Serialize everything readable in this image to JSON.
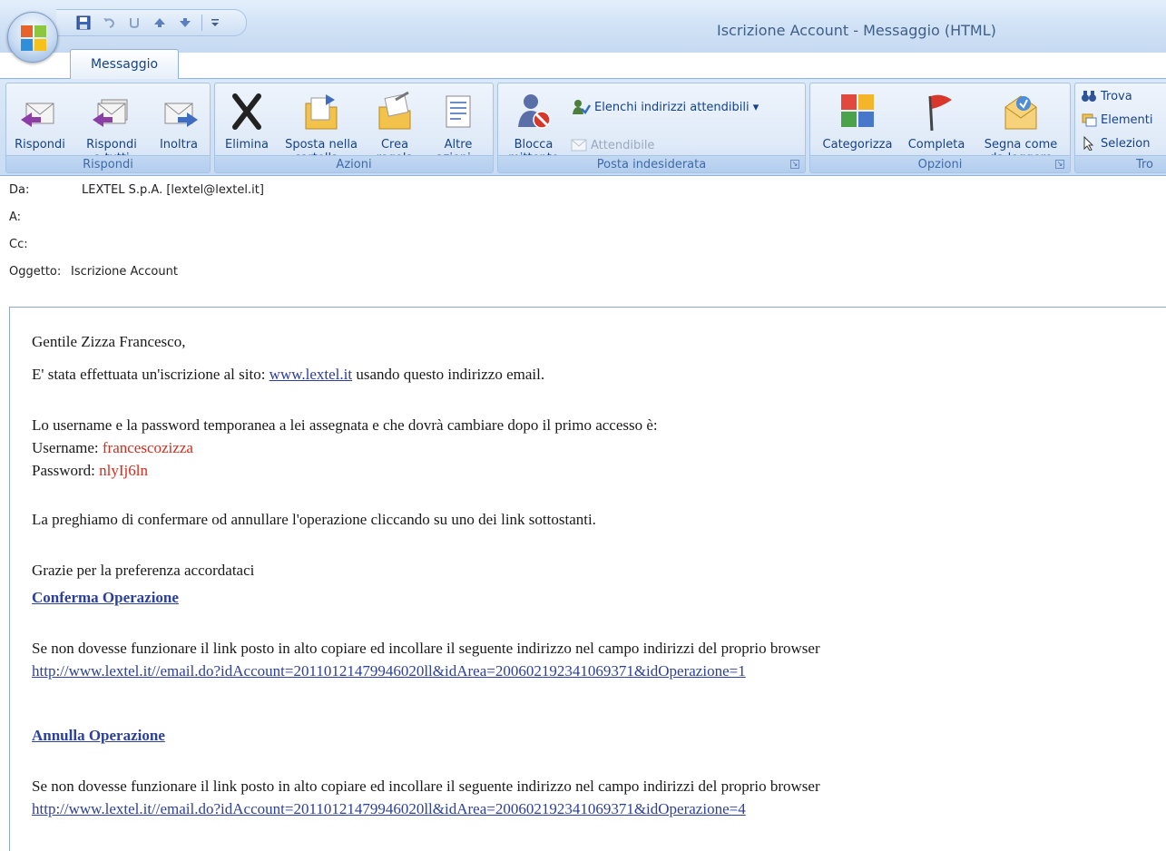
{
  "window": {
    "title": "Iscrizione Account - Messaggio (HTML)",
    "tab": "Messaggio"
  },
  "ribbon": {
    "groups": {
      "rispondi": {
        "label": "Rispondi",
        "reply": "Rispondi",
        "reply_all_1": "Rispondi",
        "reply_all_2": "a tutti",
        "forward": "Inoltra"
      },
      "azioni": {
        "label": "Azioni",
        "delete": "Elimina",
        "move_1": "Sposta nella",
        "move_2": "cartella ▾",
        "rule_1": "Crea",
        "rule_2": "regola",
        "other_1": "Altre",
        "other_2": "azioni ▾"
      },
      "posta": {
        "label": "Posta indesiderata",
        "block_1": "Blocca",
        "block_2": "mittente",
        "safe_lists": "Elenchi indirizzi attendibili ▾",
        "safe": "Attendibile"
      },
      "opzioni": {
        "label": "Opzioni",
        "categorize": "Categorizza",
        "categorize_arrow": "▾",
        "followup": "Completa",
        "followup_arrow": "▾",
        "mark_1": "Segna come",
        "mark_2": "da leggere"
      },
      "trova": {
        "label": "Tro",
        "find": "Trova",
        "related": "Elementi",
        "select": "Selezion"
      }
    }
  },
  "header": {
    "from_label": "Da:",
    "from_value": "LEXTEL S.p.A. [lextel@lextel.it]",
    "to_label": "A:",
    "to_value": "",
    "cc_label": "Cc:",
    "cc_value": "",
    "subject_label": "Oggetto:",
    "subject_value": "Iscrizione Account"
  },
  "body": {
    "greeting": "Gentile Zizza Francesco,",
    "line1_pre": "E' stata effettuata un'iscrizione al sito: ",
    "line1_link": "www.lextel.it",
    "line1_post": " usando questo indirizzo email.",
    "cred_intro": "Lo username e la password temporanea a lei assegnata e che dovrà cambiare dopo il primo accesso è:",
    "username_label": "Username: ",
    "username_value": "francescozizza",
    "password_label": "Password: ",
    "password_value": "nlyIj6ln",
    "confirm_request": "La preghiamo di confermare od annullare l'operazione cliccando su uno dei link sottostanti.",
    "thanks": "Grazie per la preferenza accordataci",
    "confirm_link": "Conferma Operazione",
    "fallback1": "Se non dovesse funzionare il link posto in alto copiare ed incollare il seguente indirizzo nel campo indirizzi del proprio browser",
    "url1": "http://www.lextel.it//email.do?idAccount=20110121479946020ll&idArea=200602192341069371&idOperazione=1",
    "cancel_link": "Annulla Operazione",
    "fallback2": "Se non dovesse funzionare il link posto in alto copiare ed incollare il seguente indirizzo nel campo indirizzi del proprio browser",
    "url2": "http://www.lextel.it//email.do?idAccount=20110121479946020ll&idArea=200602192341069371&idOperazione=4"
  }
}
